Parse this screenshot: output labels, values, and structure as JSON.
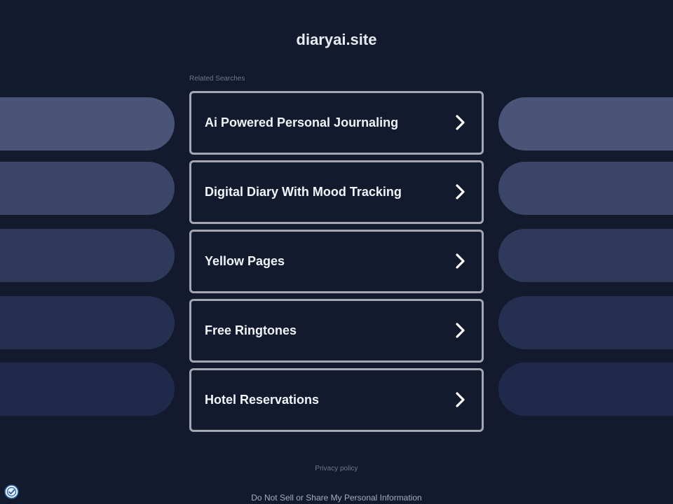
{
  "header": {
    "site_title": "diaryai.site"
  },
  "related": {
    "label": "Related Searches",
    "items": [
      {
        "label": "Ai Powered Personal Journaling",
        "icon": "chevron-right-icon"
      },
      {
        "label": "Digital Diary With Mood Tracking",
        "icon": "chevron-right-icon"
      },
      {
        "label": "Yellow Pages",
        "icon": "chevron-right-icon"
      },
      {
        "label": "Free Ringtones",
        "icon": "chevron-right-icon"
      },
      {
        "label": "Hotel Reservations",
        "icon": "chevron-right-icon"
      }
    ]
  },
  "footer": {
    "privacy_label": "Privacy policy",
    "dnsmpi_label": "Do Not Sell or Share My Personal Information",
    "consent_icon": "consent-check-icon"
  },
  "colors": {
    "background": "#131a2e",
    "title_text": "#e8ebf2",
    "item_border": "#a4a7b2",
    "item_text": "#f2f4f8",
    "muted_text": "#6e7692"
  }
}
